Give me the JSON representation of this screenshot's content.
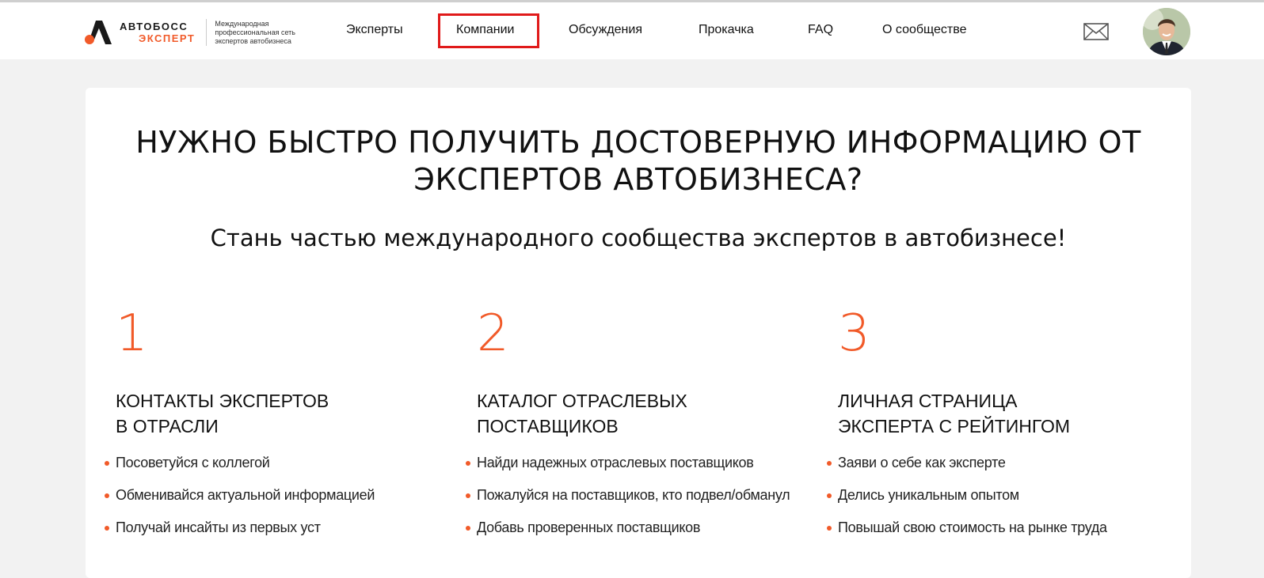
{
  "brand": {
    "name_line1": "АВТОБОСС",
    "name_line2": "ЭКСПЕРТ",
    "tagline": "Международная профессиональная сеть экспертов автобизнеса",
    "accent_color": "#f15a29"
  },
  "nav": {
    "items": [
      {
        "label": "Эксперты"
      },
      {
        "label": "Компании",
        "highlighted": true
      },
      {
        "label": "Обсуждения"
      },
      {
        "label": "Прокачка"
      },
      {
        "label": "FAQ"
      },
      {
        "label": "О сообществе"
      }
    ],
    "icons": [
      "mail-icon",
      "user-avatar"
    ]
  },
  "hero": {
    "title": "НУЖНО БЫСТРО ПОЛУЧИТЬ ДОСТОВЕРНУЮ ИНФОРМАЦИЮ ОТ ЭКСПЕРТОВ АВТОБИЗНЕСА?",
    "subtitle": "Стань частью международного сообщества экспертов в автобизнесе!"
  },
  "features": [
    {
      "number": "1",
      "title": "Контакты экспертов\nв отрасли",
      "bullets": [
        "Посоветуйся с коллегой",
        "Обменивайся актуальной информацией",
        "Получай инсайты из первых уст"
      ]
    },
    {
      "number": "2",
      "title": "Каталог отраслевых\nпоставщиков",
      "bullets": [
        "Найди надежных отраслевых поставщиков",
        "Пожалуйся на поставщиков, кто подвел/обманул",
        "Добавь проверенных поставщиков"
      ]
    },
    {
      "number": "3",
      "title": "Личная страница\nэксперта с рейтингом",
      "bullets": [
        "Заяви о себе как эксперте",
        "Делись уникальным опытом",
        "Повышай свою стоимость на рынке труда"
      ]
    }
  ]
}
